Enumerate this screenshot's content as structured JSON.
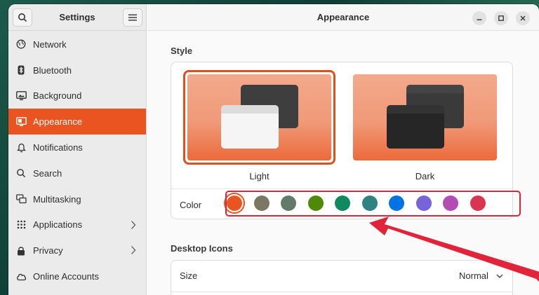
{
  "sidebar": {
    "title": "Settings",
    "items": [
      {
        "label": "Network",
        "icon": "network-globe-icon"
      },
      {
        "label": "Bluetooth",
        "icon": "bluetooth-icon"
      },
      {
        "label": "Background",
        "icon": "background-monitor-icon"
      },
      {
        "label": "Appearance",
        "icon": "appearance-icon",
        "active": true
      },
      {
        "label": "Notifications",
        "icon": "bell-icon"
      },
      {
        "label": "Search",
        "icon": "search-icon"
      },
      {
        "label": "Multitasking",
        "icon": "multitasking-icon"
      },
      {
        "label": "Applications",
        "icon": "apps-grid-icon",
        "chevron": true
      },
      {
        "label": "Privacy",
        "icon": "lock-icon",
        "chevron": true
      },
      {
        "label": "Online Accounts",
        "icon": "cloud-icon"
      }
    ]
  },
  "main": {
    "title": "Appearance",
    "style": {
      "heading": "Style",
      "themes": [
        {
          "label": "Light",
          "selected": true
        },
        {
          "label": "Dark",
          "selected": false
        }
      ]
    },
    "color": {
      "label": "Color",
      "swatches": [
        "#e95420",
        "#7b7763",
        "#657b69",
        "#4e8a08",
        "#0f8a5e",
        "#308280",
        "#0073e5",
        "#7764d8",
        "#b34cb3",
        "#da3450"
      ],
      "selected_index": 0
    },
    "desktop_icons": {
      "heading": "Desktop Icons",
      "size_label": "Size",
      "size_value": "Normal"
    }
  },
  "colors": {
    "accent": "#e95420",
    "annotation": "#e0243a"
  }
}
